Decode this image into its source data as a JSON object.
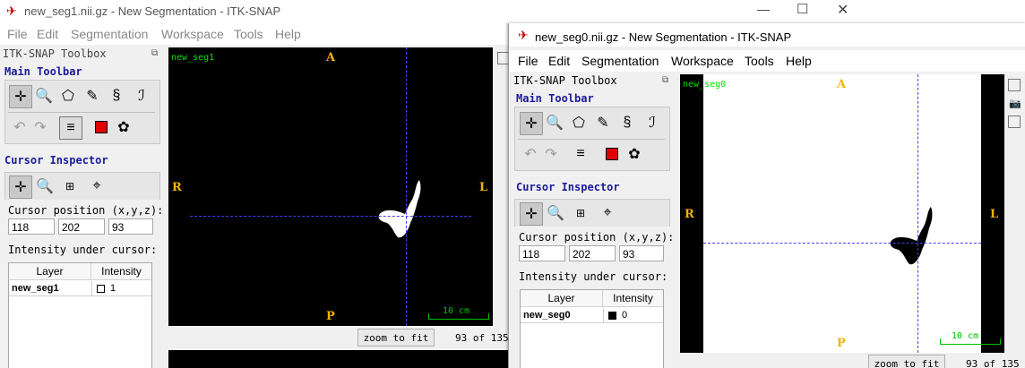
{
  "win1": {
    "title": "new_seg1.nii.gz - New Segmentation - ITK-SNAP",
    "menu": [
      "File",
      "Segmentation",
      "Workspace",
      "Tools",
      "Help"
    ],
    "toolbox_title": "ITK-SNAP Toolbox",
    "main_toolbar": "Main Toolbar",
    "cursor_inspector": "Cursor Inspector",
    "cursor_position_label": "Cursor position (x,y,z):",
    "cursor": [
      "118",
      "202",
      "93"
    ],
    "intensity_label": "Intensity under cursor:",
    "table_headers": [
      "Layer",
      "Intensity"
    ],
    "layer_name": "new_seg1",
    "layer_value": "1",
    "view_label": "new_seg1",
    "orient": {
      "top": "A",
      "bottom": "P",
      "left": "R",
      "right": "L"
    },
    "scale": "10 cm",
    "zoom_to_fit": "zoom to fit",
    "slice": "93 of 135"
  },
  "win2": {
    "title": "new_seg0.nii.gz - New Segmentation - ITK-SNAP",
    "menu": [
      "File",
      "Edit",
      "Segmentation",
      "Workspace",
      "Tools",
      "Help"
    ],
    "toolbox_title": "ITK-SNAP Toolbox",
    "main_toolbar": "Main Toolbar",
    "cursor_inspector": "Cursor Inspector",
    "cursor_position_label": "Cursor position (x,y,z):",
    "cursor": [
      "118",
      "202",
      "93"
    ],
    "intensity_label": "Intensity under cursor:",
    "table_headers": [
      "Layer",
      "Intensity"
    ],
    "layer_name": "new_seg0",
    "layer_value": "0",
    "view_label": "new_seg0",
    "orient": {
      "top": "A",
      "bottom": "P",
      "left": "R",
      "right": "L"
    },
    "scale": "10 cm",
    "zoom_to_fit": "zoom to fit",
    "slice": "93 of 135"
  },
  "colors": {
    "orientation": "#f0b400",
    "crosshair": "#4040ff",
    "section_title": "#1b1b9a",
    "scale": "#00c000"
  }
}
